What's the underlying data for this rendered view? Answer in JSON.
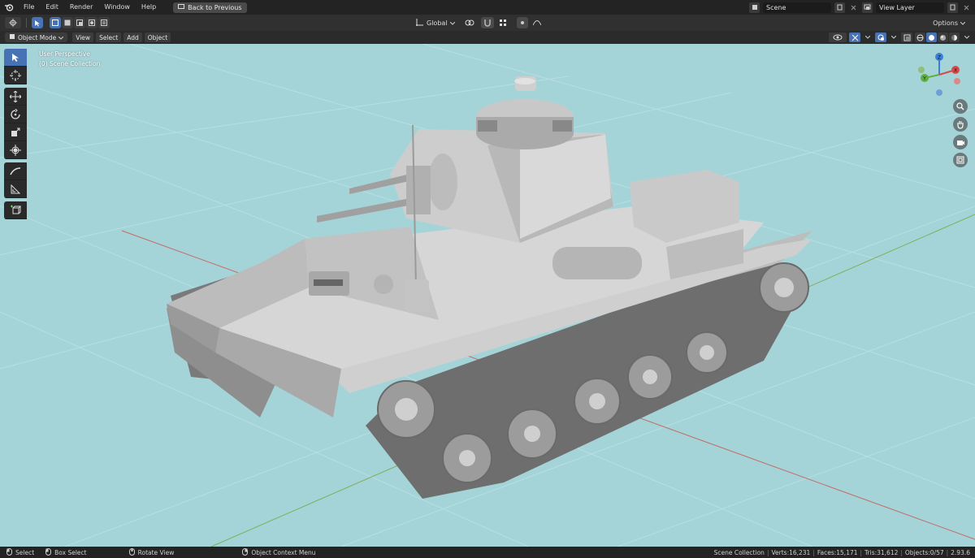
{
  "menu": {
    "items": [
      "File",
      "Edit",
      "Render",
      "Window",
      "Help"
    ],
    "back_button": "Back to Previous"
  },
  "top_right": {
    "scene": "Scene",
    "view_layer": "View Layer"
  },
  "header": {
    "orientation": "Global",
    "options": "Options"
  },
  "viewport_header": {
    "mode": "Object Mode",
    "menus": [
      "View",
      "Select",
      "Add",
      "Object"
    ]
  },
  "viewport": {
    "perspective": "User Perspective",
    "collection": "(0) Scene Collection",
    "background": "#a5d4d8"
  },
  "gizmo": {
    "x": "X",
    "y": "Y",
    "z": "Z"
  },
  "statusbar": {
    "select": "Select",
    "box_select": "Box Select",
    "rotate_view": "Rotate View",
    "context_menu": "Object Context Menu",
    "collection": "Scene Collection",
    "verts": "Verts:16,231",
    "faces": "Faces:15,171",
    "tris": "Tris:31,612",
    "objects": "Objects:0/57",
    "version": "2.93.6"
  },
  "colors": {
    "accent": "#4772b3",
    "viewport_bg": "#a5d4d8"
  }
}
